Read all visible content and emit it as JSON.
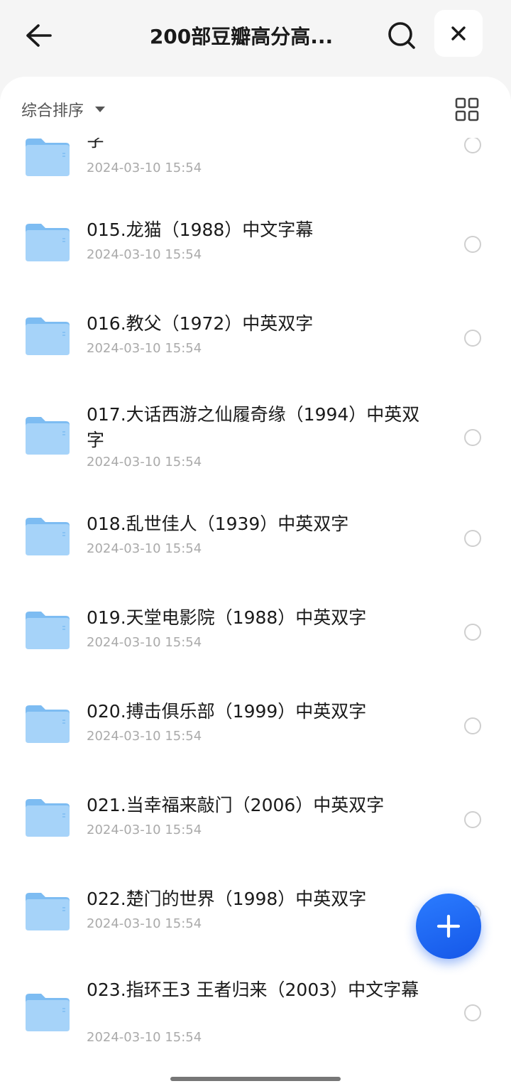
{
  "header": {
    "back_icon": "arrow-left-icon",
    "title": "200部豆瓣高分高...",
    "search_icon": "search-icon",
    "close_icon": "close-icon"
  },
  "toolbar": {
    "sort_label": "综合排序",
    "view_toggle_icon": "grid-view-icon"
  },
  "files": [
    {
      "name": "字",
      "date": "2024-03-10 15:54"
    },
    {
      "name": "015.龙猫（1988）中文字幕",
      "date": "2024-03-10 15:54"
    },
    {
      "name": "016.教父（1972）中英双字",
      "date": "2024-03-10 15:54"
    },
    {
      "name": "017.大话西游之仙履奇缘（1994）中英双字",
      "date": "2024-03-10 15:54"
    },
    {
      "name": "018.乱世佳人（1939）中英双字",
      "date": "2024-03-10 15:54"
    },
    {
      "name": "019.天堂电影院（1988）中英双字",
      "date": "2024-03-10 15:54"
    },
    {
      "name": "020.搏击俱乐部（1999）中英双字",
      "date": "2024-03-10 15:54"
    },
    {
      "name": "021.当幸福来敲门（2006）中英双字",
      "date": "2024-03-10 15:54"
    },
    {
      "name": "022.楚门的世界（1998）中英双字",
      "date": "2024-03-10 15:54"
    },
    {
      "name": "023.指环王3 王者归来（2003）中文字幕",
      "date": "2024-03-10 15:54"
    }
  ],
  "fab_icon": "plus-icon",
  "colors": {
    "accent": "#1f6bf5",
    "folder": "#9fd0f8",
    "date_text": "#aaaaaa"
  }
}
